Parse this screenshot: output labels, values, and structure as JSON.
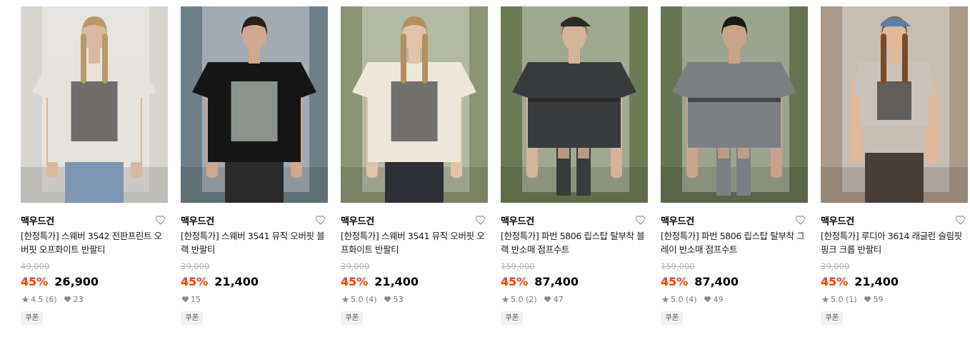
{
  "colors": {
    "discount": "#ff3c00",
    "original_price": "#b3b3b3",
    "meta": "#7a7a7a",
    "coupon_bg": "#f2f2f2"
  },
  "icons": {
    "like": "heart-outline-icon",
    "rating": "star-icon",
    "likes_count": "heart-filled-icon"
  },
  "products": [
    {
      "brand": "맥우드건",
      "name": "[한정특가] 스웨버 3542 전판프린트 오버핏 오프화이트 반팔티",
      "original_price": "49,000",
      "discount": "45%",
      "price": "26,900",
      "rating": "4.5 (6)",
      "likes": "23",
      "coupon": "쿠폰",
      "image": {
        "bg": "#d9d6d1",
        "garment": "#e6e3dc",
        "print": "#3a3a3a",
        "skin": "#d8b9a0",
        "hair": "#b89a6a",
        "bottom": "#7f96b0"
      }
    },
    {
      "brand": "맥우드건",
      "name": "[한정특가] 스웨버 3541 뮤직 오버핏 블랙 반팔티",
      "original_price": "39,000",
      "discount": "45%",
      "price": "21,400",
      "rating": "",
      "likes": "15",
      "coupon": "쿠폰",
      "image": {
        "bg": "#6f7f88",
        "garment": "#151515",
        "print": "#bfc9c0",
        "skin": "#cfa88e",
        "hair": "#2a2018",
        "bottom": "#2a2a2a"
      }
    },
    {
      "brand": "맥우드건",
      "name": "[한정특가] 스웨버 3541 뮤직 오버핏 오프화이트 반팔티",
      "original_price": "39,000",
      "discount": "45%",
      "price": "21,400",
      "rating": "5.0 (4)",
      "likes": "53",
      "coupon": "쿠폰",
      "image": {
        "bg": "#8b9474",
        "garment": "#ece7da",
        "print": "#3d3d3d",
        "skin": "#e2c3aa",
        "hair": "#b58f5e",
        "bottom": "#2f2f38"
      }
    },
    {
      "brand": "맥우드건",
      "name": "[한정특가] 파번 5806 립스탑 탈부착 블랙 반소매 점프수트",
      "original_price": "159,000",
      "discount": "45%",
      "price": "87,400",
      "rating": "5.0 (2)",
      "likes": "47",
      "coupon": "쿠폰",
      "image": {
        "bg": "#6c7a55",
        "garment": "#3a3b3d",
        "print": "#3a3b3d",
        "skin": "#d4b39a",
        "hair": "#8c6a42",
        "bottom": "#3a3b3d"
      }
    },
    {
      "brand": "맥우드건",
      "name": "[한정특가] 파번 5806 립스탑 탈부착 그레이 반소매 점프수트",
      "original_price": "159,000",
      "discount": "45%",
      "price": "87,400",
      "rating": "5.0 (4)",
      "likes": "49",
      "coupon": "쿠폰",
      "image": {
        "bg": "#667454",
        "garment": "#7c7f82",
        "print": "#7c7f82",
        "skin": "#c9a48a",
        "hair": "#1e1a17",
        "bottom": "#7c7f82"
      }
    },
    {
      "brand": "맥우드건",
      "name": "[한정특가] 루디아 3614 래글런 슬림핏 핑크 크롭 반팔티",
      "original_price": "39,000",
      "discount": "45%",
      "price": "21,400",
      "rating": "5.0 (1)",
      "likes": "59",
      "coupon": "쿠폰",
      "image": {
        "bg": "#a99a8a",
        "garment": "#c9c2bb",
        "print": "#333333",
        "skin": "#e0b89a",
        "hair": "#7a4a2a",
        "bottom": "#4a3f38"
      }
    }
  ]
}
